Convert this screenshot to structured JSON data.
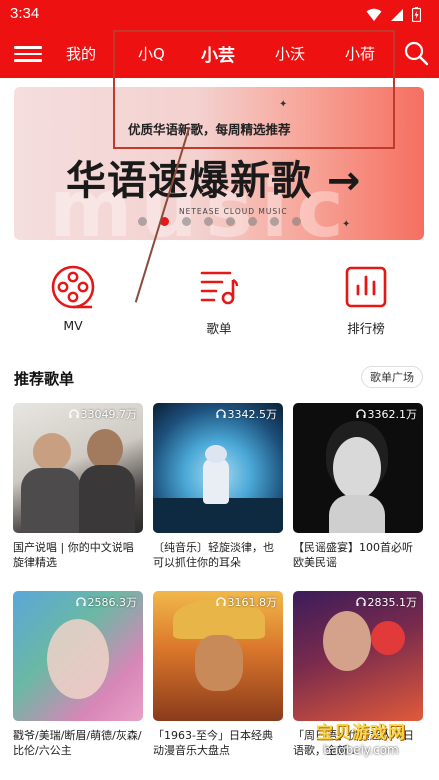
{
  "status": {
    "time": "3:34"
  },
  "nav": {
    "tabs": [
      {
        "label": "我的"
      },
      {
        "label": "小Q"
      },
      {
        "label": "小芸"
      },
      {
        "label": "小沃"
      },
      {
        "label": "小荷"
      }
    ],
    "active_tab": "小芸"
  },
  "banner": {
    "subtitle": "优质华语新歌，每周精选推荐",
    "title": "华语速爆新歌 →",
    "bg_text": "music",
    "brand": "NETEASE CLOUD MUSIC",
    "dots": 8,
    "active_dot": 1
  },
  "quick_entries": [
    {
      "label": "MV",
      "icon": "film-reel-icon"
    },
    {
      "label": "歌单",
      "icon": "playlist-icon"
    },
    {
      "label": "排行榜",
      "icon": "chart-bar-icon"
    }
  ],
  "section": {
    "title": "推荐歌单",
    "more": "歌单广场"
  },
  "playlists": [
    {
      "count": "33049.7万",
      "title": "国产说唱 | 你的中文说唱旋律精选"
    },
    {
      "count": "3342.5万",
      "title": "〔纯音乐〕轻旋淡律，也可以抓住你的耳朵"
    },
    {
      "count": "3362.1万",
      "title": "【民谣盛宴】100首必听欧美民谣"
    },
    {
      "count": "2586.3万",
      "title": "戳爷/美瑞/断眉/萌德/灰森/比伦/六公主"
    },
    {
      "count": "3161.8万",
      "title": "「1963-至今」日本经典动漫音乐大盘点"
    },
    {
      "count": "2835.1万",
      "title": "「周日语」优质超人气日语歌，全新..."
    }
  ],
  "watermark": {
    "main": "宝贝游戏网",
    "url": "baobeiy.com"
  },
  "colors": {
    "brand_red": "#ee1111",
    "accent_red": "#e61717"
  }
}
